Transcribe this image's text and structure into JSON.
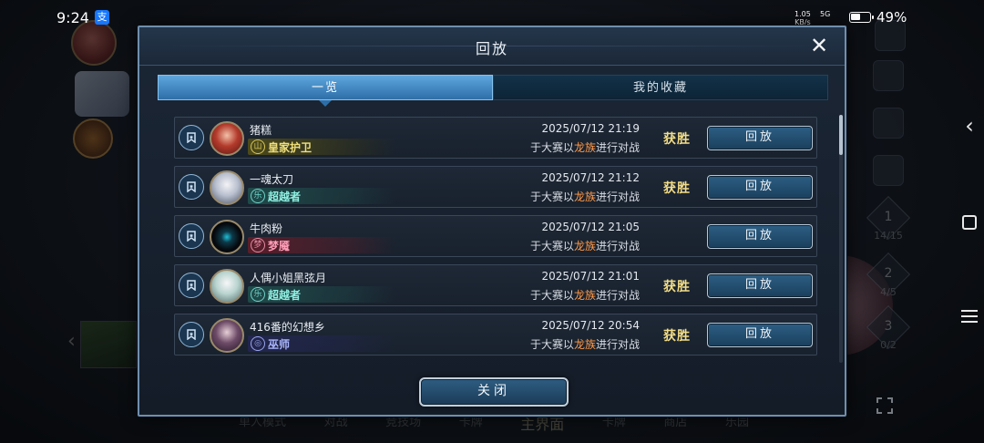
{
  "status_bar": {
    "time": "9:24",
    "alipay_glyph": "支",
    "net_speed": "1.05",
    "net_unit": "KB/s",
    "signal": "5G",
    "battery": "49%"
  },
  "background": {
    "bottom_nav": [
      "单人模式",
      "对战",
      "竞技场",
      "卡牌",
      "主界面",
      "卡牌",
      "商店",
      "乐园"
    ],
    "stages": [
      {
        "num": "1",
        "progress": "14/15"
      },
      {
        "num": "2",
        "progress": "4/5"
      },
      {
        "num": "3",
        "progress": "0/2"
      }
    ]
  },
  "dialog": {
    "title": "回放",
    "close_icon": "close-x-icon",
    "tabs": [
      {
        "label": "一览",
        "active": true
      },
      {
        "label": "我的收藏",
        "active": false
      }
    ],
    "rows": [
      {
        "player": "猪糕",
        "title": "皇家护卫",
        "title_style": "royal",
        "title_glyph": "山",
        "datetime": "2025/07/12  21:19",
        "mode_prefix": "于大赛以",
        "deck": "龙族",
        "mode_suffix": "进行对战",
        "result": "获胜",
        "button": "回放",
        "avatar": "av-1"
      },
      {
        "player": "一魂太刀",
        "title": "超越者",
        "title_style": "trans",
        "title_glyph": "乐",
        "datetime": "2025/07/12  21:12",
        "mode_prefix": "于大赛以",
        "deck": "龙族",
        "mode_suffix": "进行对战",
        "result": "获胜",
        "button": "回放",
        "avatar": "av-2"
      },
      {
        "player": "牛肉粉",
        "title": "梦魇",
        "title_style": "night",
        "title_glyph": "梦",
        "datetime": "2025/07/12  21:05",
        "mode_prefix": "于大赛以",
        "deck": "龙族",
        "mode_suffix": "进行对战",
        "result": "",
        "button": "回放",
        "avatar": "av-3"
      },
      {
        "player": "人偶小姐黑弦月",
        "title": "超越者",
        "title_style": "trans",
        "title_glyph": "乐",
        "datetime": "2025/07/12  21:01",
        "mode_prefix": "于大赛以",
        "deck": "龙族",
        "mode_suffix": "进行对战",
        "result": "获胜",
        "button": "回放",
        "avatar": "av-4"
      },
      {
        "player": "416番的幻想乡",
        "title": "巫师",
        "title_style": "mage",
        "title_glyph": "◎",
        "datetime": "2025/07/12  20:54",
        "mode_prefix": "于大赛以",
        "deck": "龙族",
        "mode_suffix": "进行对战",
        "result": "获胜",
        "button": "回放",
        "avatar": "av-5"
      }
    ],
    "close_button": "关闭"
  },
  "colors": {
    "accent_tab": "#3d8ac8",
    "win_gold": "#f3dd86",
    "deck_orange": "#ff9a4a",
    "dialog_border": "#6f8fae"
  }
}
